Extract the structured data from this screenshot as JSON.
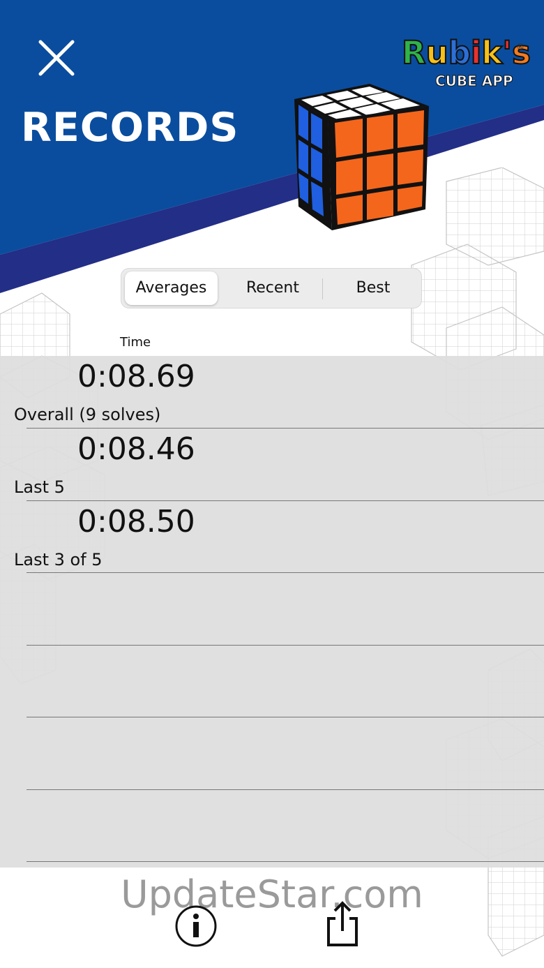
{
  "header": {
    "title": "RECORDS",
    "close_icon": "close-icon",
    "logo": {
      "top": "Rubik's",
      "bottom": "CUBE APP",
      "registered": "®"
    },
    "colors": {
      "header_blue": "#0a4d9e",
      "stripe_blue": "#232e86"
    }
  },
  "tabs": [
    {
      "label": "Averages",
      "active": true
    },
    {
      "label": "Recent",
      "active": false
    },
    {
      "label": "Best",
      "active": false
    }
  ],
  "table": {
    "column_header": "Time",
    "rows": [
      {
        "time": "0:08.69",
        "label": "Overall (9 solves)"
      },
      {
        "time": "0:08.46",
        "label": "Last 5"
      },
      {
        "time": "0:08.50",
        "label": "Last 3 of 5"
      },
      {
        "time": "",
        "label": ""
      },
      {
        "time": "",
        "label": ""
      },
      {
        "time": "",
        "label": ""
      },
      {
        "time": "",
        "label": ""
      }
    ]
  },
  "footer": {
    "watermark": "UpdateStar.com",
    "info_icon": "info-icon",
    "share_icon": "share-icon"
  }
}
